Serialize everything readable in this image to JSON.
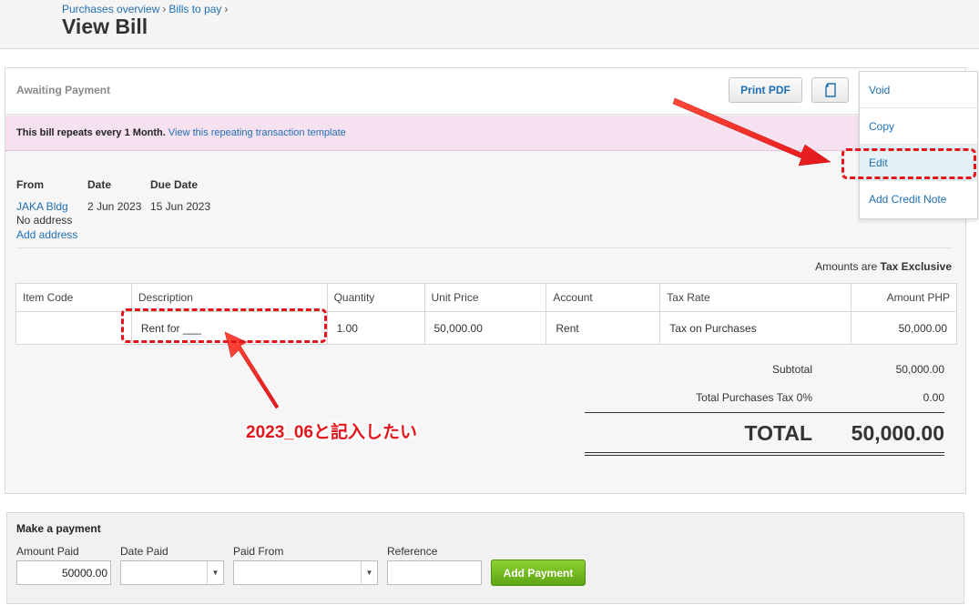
{
  "breadcrumb": {
    "items": [
      "Purchases overview",
      "Bills to pay"
    ],
    "separator": "›"
  },
  "page": {
    "title": "View Bill"
  },
  "bill": {
    "status": "Awaiting Payment",
    "print_pdf_label": "Print PDF",
    "repeat_text": "This bill repeats every 1 Month.",
    "repeat_link": "View this repeating transaction template",
    "from_label": "From",
    "date_label": "Date",
    "due_date_label": "Due Date",
    "from_name": "JAKA Bldg",
    "address": "No address",
    "add_address": "Add address",
    "date": "2 Jun 2023",
    "due_date": "15 Jun 2023",
    "amounts_are": "Amounts are",
    "tax_mode": "Tax Exclusive"
  },
  "table": {
    "headers": [
      "Item Code",
      "Description",
      "Quantity",
      "Unit Price",
      "Account",
      "Tax Rate",
      "Amount PHP"
    ],
    "rows": [
      {
        "item_code": "",
        "description": "Rent for ___",
        "quantity": "1.00",
        "unit_price": "50,000.00",
        "account": "Rent",
        "tax_rate": "Tax on Purchases",
        "amount": "50,000.00"
      }
    ]
  },
  "totals": {
    "subtotal_label": "Subtotal",
    "subtotal": "50,000.00",
    "tax_label": "Total Purchases Tax 0%",
    "tax": "0.00",
    "total_label": "TOTAL",
    "total": "50,000.00"
  },
  "menu": {
    "items": [
      "Void",
      "Copy",
      "Edit",
      "Add Credit Note"
    ],
    "active_index": 2
  },
  "payment": {
    "title": "Make a payment",
    "amount_label": "Amount Paid",
    "amount_value": "50000.00",
    "date_label": "Date Paid",
    "date_value": "",
    "from_label": "Paid From",
    "from_value": "",
    "reference_label": "Reference",
    "reference_value": "",
    "add_button": "Add Payment"
  },
  "annotation": {
    "text": "2023_06と記入したい",
    "color": "#e2161a"
  },
  "colors": {
    "link": "#1f6fb2",
    "repeat_bg": "#f6e1f0",
    "add_payment": "#6cb61e",
    "annotation": "#e2161a"
  },
  "icons": {
    "copy_doc": "document-icon",
    "dropdown": "chevron-down-icon"
  }
}
